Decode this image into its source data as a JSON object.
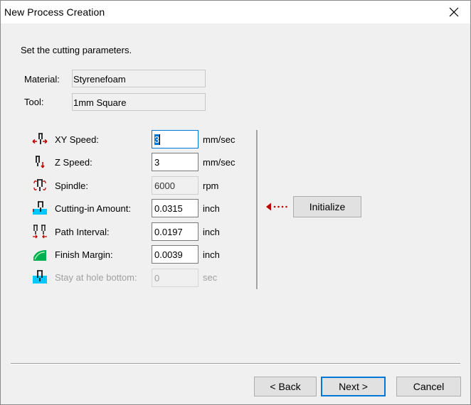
{
  "window": {
    "title": "New Process Creation"
  },
  "instructions": "Set the cutting parameters.",
  "material": {
    "label": "Material:",
    "value": "Styrenefoam"
  },
  "tool": {
    "label": "Tool:",
    "value": "1mm Square"
  },
  "params": [
    {
      "icon": "xy-speed-icon",
      "label": "XY Speed:",
      "value": "3",
      "unit": "mm/sec",
      "state": "focused"
    },
    {
      "icon": "z-speed-icon",
      "label": "Z Speed:",
      "value": "3",
      "unit": "mm/sec",
      "state": "editable"
    },
    {
      "icon": "spindle-icon",
      "label": "Spindle:",
      "value": "6000",
      "unit": "rpm",
      "state": "readonly"
    },
    {
      "icon": "cutting-in-icon",
      "label": "Cutting-in Amount:",
      "value": "0.0315",
      "unit": "inch",
      "state": "editable"
    },
    {
      "icon": "path-interval-icon",
      "label": "Path Interval:",
      "value": "0.0197",
      "unit": "inch",
      "state": "editable"
    },
    {
      "icon": "finish-margin-icon",
      "label": "Finish Margin:",
      "value": "0.0039",
      "unit": "inch",
      "state": "editable"
    },
    {
      "icon": "hole-bottom-icon",
      "label": "Stay at hole bottom:",
      "value": "0",
      "unit": "sec",
      "state": "disabled"
    }
  ],
  "initialize_label": "Initialize",
  "buttons": {
    "back": "< Back",
    "next": "Next >",
    "cancel": "Cancel"
  },
  "colors": {
    "accent": "#0078d7",
    "arrow": "#c00000",
    "icon_cyan": "#00c8ff",
    "icon_green": "#00b050"
  }
}
